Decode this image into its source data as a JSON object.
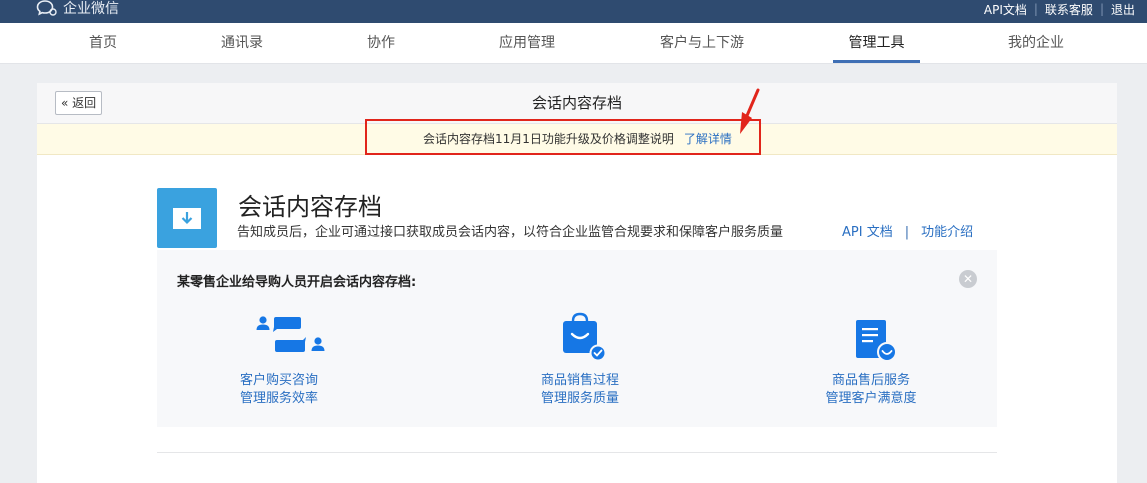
{
  "header": {
    "logo_text": "企业微信",
    "links": [
      "API文档",
      "联系客服",
      "退出"
    ]
  },
  "nav": {
    "items": [
      "首页",
      "通讯录",
      "协作",
      "应用管理",
      "客户与上下游",
      "管理工具",
      "我的企业"
    ],
    "active": "管理工具"
  },
  "panel": {
    "back_label": "« 返回",
    "title": "会话内容存档"
  },
  "notice": {
    "text": "会话内容存档11月1日功能升级及价格调整说明",
    "link": "了解详情"
  },
  "app": {
    "title": "会话内容存档",
    "description": "告知成员后，企业可通过接口获取成员会话内容，以符合企业监管合规要求和保障客户服务质量",
    "links": [
      "API 文档",
      "功能介绍"
    ]
  },
  "case": {
    "title": "某零售企业给导购人员开启会话内容存档:",
    "features": [
      {
        "icon": "chat-users-icon",
        "line1": "客户购买咨询",
        "line2": "管理服务效率"
      },
      {
        "icon": "shopping-bag-check-icon",
        "line1": "商品销售过程",
        "line2": "管理服务质量"
      },
      {
        "icon": "document-smile-icon",
        "line1": "商品售后服务",
        "line2": "管理客户满意度"
      }
    ]
  },
  "colors": {
    "topbar": "#2f4b70",
    "accent": "#2a6fc2",
    "icon_blue": "#1677e5",
    "highlight_red": "#e1251b",
    "notice_bg": "#fffbe6"
  }
}
